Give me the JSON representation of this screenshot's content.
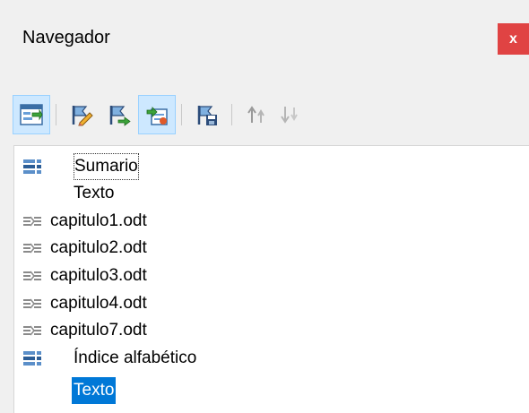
{
  "window": {
    "title": "Navegador",
    "close_label": "x"
  },
  "toolbar": {
    "buttons": [
      {
        "name": "navigation-toggle-button",
        "icon": "navigator-icon",
        "active": true
      },
      {
        "name": "edit-button",
        "icon": "pencil-icon",
        "active": false
      },
      {
        "name": "update-button",
        "icon": "flag-arrow-icon",
        "active": false
      },
      {
        "name": "insert-button",
        "icon": "insert-document-icon",
        "active": true
      },
      {
        "name": "save-as-button",
        "icon": "save-flag-icon",
        "active": false
      },
      {
        "name": "move-up-button",
        "icon": "move-up-icon",
        "active": false,
        "disabled": true
      },
      {
        "name": "move-down-button",
        "icon": "move-down-icon",
        "active": false,
        "disabled": true
      }
    ]
  },
  "tree": {
    "items": [
      {
        "label": "Sumario",
        "icon": "index-icon",
        "state": "focused"
      },
      {
        "label": "Texto",
        "icon": "",
        "state": ""
      },
      {
        "label": "capitulo1.odt",
        "icon": "link-icon",
        "state": ""
      },
      {
        "label": "capitulo2.odt",
        "icon": "link-icon",
        "state": ""
      },
      {
        "label": "capitulo3.odt",
        "icon": "link-icon",
        "state": ""
      },
      {
        "label": "capitulo4.odt",
        "icon": "link-icon",
        "state": ""
      },
      {
        "label": "capitulo7.odt",
        "icon": "link-icon",
        "state": ""
      },
      {
        "label": "Índice alfabético",
        "icon": "index-icon",
        "state": ""
      },
      {
        "label": "Texto",
        "icon": "",
        "state": "selected"
      }
    ]
  },
  "colors": {
    "close_bg": "#e04343",
    "selection_bg": "#0078d7",
    "active_button_bg": "#cde8ff"
  }
}
